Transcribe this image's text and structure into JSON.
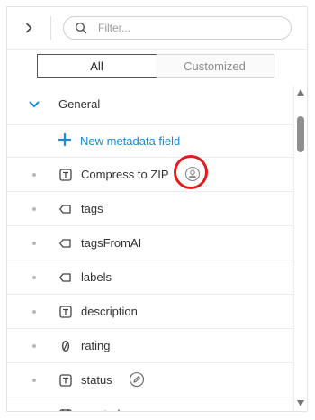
{
  "header": {
    "expand_icon": "chevron-right-icon",
    "filter": {
      "placeholder": "Filter...",
      "value": ""
    }
  },
  "tabs": [
    {
      "label": "All",
      "active": true
    },
    {
      "label": "Customized",
      "active": false
    }
  ],
  "group": {
    "label": "General",
    "icon": "chevron-down-icon",
    "expanded": true
  },
  "new_field": {
    "label": "New metadata field",
    "icon": "plus-icon"
  },
  "fields": [
    {
      "label": "Compress to ZIP",
      "icon": "text-field-icon",
      "badge": "user-icon",
      "highlighted": true
    },
    {
      "label": "tags",
      "icon": "tag-icon"
    },
    {
      "label": "tagsFromAI",
      "icon": "tag-icon"
    },
    {
      "label": "labels",
      "icon": "tag-icon"
    },
    {
      "label": "description",
      "icon": "text-field-icon"
    },
    {
      "label": "rating",
      "icon": "number-icon"
    },
    {
      "label": "status",
      "icon": "text-field-icon",
      "badge": "edit-icon"
    },
    {
      "label": "created",
      "icon": "calendar-icon"
    }
  ],
  "colors": {
    "accent": "#1a8ad1",
    "highlight": "#e01b1b",
    "border": "#ececec"
  }
}
